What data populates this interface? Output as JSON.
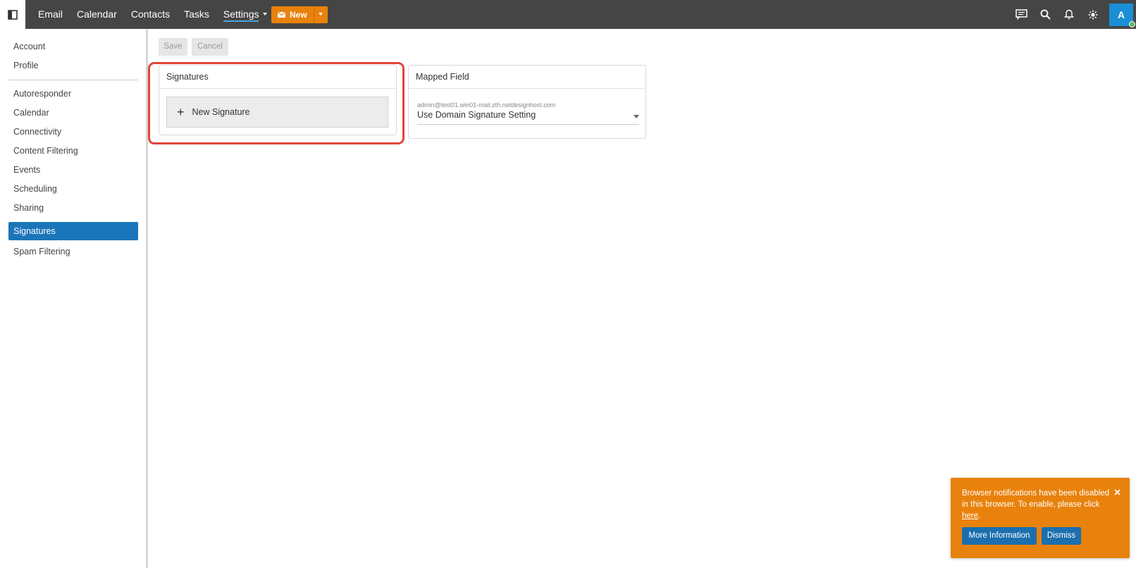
{
  "topbar": {
    "nav": [
      "Email",
      "Calendar",
      "Contacts",
      "Tasks",
      "Settings"
    ],
    "active_nav": "Settings",
    "new_button": "New",
    "avatar_letter": "A",
    "accent": "#454545",
    "new_color": "#e8820c"
  },
  "sidebar": {
    "group1": [
      "Account",
      "Profile"
    ],
    "group2": [
      "Autoresponder",
      "Calendar",
      "Connectivity",
      "Content Filtering",
      "Events",
      "Scheduling",
      "Sharing",
      "Signatures",
      "Spam Filtering"
    ],
    "active": "Signatures"
  },
  "toolbar": {
    "save": "Save",
    "cancel": "Cancel"
  },
  "signatures_card": {
    "title": "Signatures",
    "new_signature": "New Signature"
  },
  "mapped_card": {
    "title": "Mapped Field",
    "email": "admin@test01.win01-mail.zth.netdesignhost.com",
    "selected": "Use Domain Signature Setting"
  },
  "toast": {
    "text_before": "Browser notifications have been disabled in this browser. To enable, please click ",
    "link": "here",
    "text_after": ".",
    "more_info": "More Information",
    "dismiss": "Dismiss"
  }
}
